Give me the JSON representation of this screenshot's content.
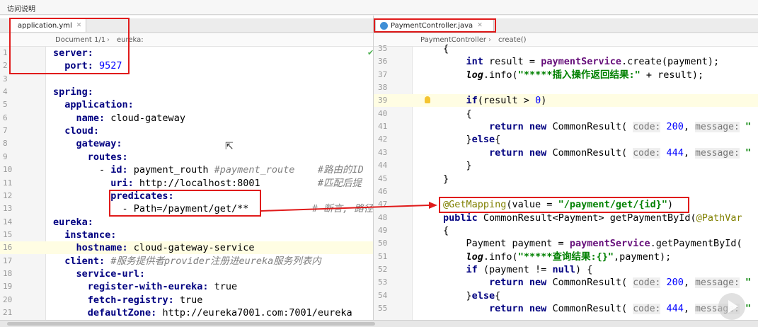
{
  "window": {
    "title": "访问说明"
  },
  "left": {
    "tab_label": "application.yml",
    "breadcrumb": [
      "Document 1/1",
      "›",
      "eureka:"
    ],
    "lines": [
      {
        "n": "1",
        "html": "<span class=\"kw\">server:</span>"
      },
      {
        "n": "2",
        "html": "  <span class=\"kw\">port:</span> <span class=\"num\">9527</span>"
      },
      {
        "n": "3",
        "html": ""
      },
      {
        "n": "4",
        "html": "<span class=\"kw\">spring:</span>"
      },
      {
        "n": "5",
        "html": "  <span class=\"kw\">application:</span>"
      },
      {
        "n": "6",
        "html": "    <span class=\"kw\">name:</span> cloud-gateway"
      },
      {
        "n": "7",
        "html": "  <span class=\"kw\">cloud:</span>"
      },
      {
        "n": "8",
        "html": "    <span class=\"kw\">gateway:</span>"
      },
      {
        "n": "9",
        "html": "      <span class=\"kw\">routes:</span>"
      },
      {
        "n": "10",
        "html": "        - <span class=\"kw\">id:</span> payment_routh <span class=\"cmt\">#payment_route    #路由的ID</span>"
      },
      {
        "n": "11",
        "html": "          <span class=\"kw\">uri:</span> http://localhost:8001          <span class=\"cmt\">#匹配后提</span>"
      },
      {
        "n": "12",
        "html": "          <span class=\"kw\">predicates:</span>"
      },
      {
        "n": "13",
        "html": "            - Path=/payment/get/**           <span class=\"cmt\"># 断言, 路径</span>"
      },
      {
        "n": "14",
        "html": "<span class=\"kw\">eureka:</span>"
      },
      {
        "n": "15",
        "html": "  <span class=\"kw\">instance:</span>"
      },
      {
        "n": "16",
        "html": "    <span class=\"kw\">hostname:</span> cloud-gateway-service"
      },
      {
        "n": "17",
        "html": "  <span class=\"kw\">client:</span> <span class=\"cmt\">#服务提供者provider注册进eureka服务列表内</span>"
      },
      {
        "n": "18",
        "html": "    <span class=\"kw\">service-url:</span>"
      },
      {
        "n": "19",
        "html": "      <span class=\"kw\">register-with-eureka:</span> true"
      },
      {
        "n": "20",
        "html": "      <span class=\"kw\">fetch-registry:</span> true"
      },
      {
        "n": "21",
        "html": "      <span class=\"kw\">defaultZone:</span> http://eureka7001.com:7001/eureka"
      }
    ]
  },
  "right": {
    "tab_label": "PaymentController.java",
    "breadcrumb": [
      "PaymentController",
      "›",
      "create()"
    ],
    "lines": [
      {
        "n": "35",
        "html": "{"
      },
      {
        "n": "36",
        "html": "    <span class=\"kw\">int</span> result = <span class=\"fn\">paymentService</span>.create(payment);"
      },
      {
        "n": "37",
        "html": "    <span class=\"it\">log</span>.info(<span class=\"str\">\"*****插入操作返回结果:\"</span> + result);"
      },
      {
        "n": "38",
        "html": ""
      },
      {
        "n": "39",
        "html": "    <span class=\"kw\">if</span>(result > <span class=\"num\">0</span>)"
      },
      {
        "n": "40",
        "html": "    {"
      },
      {
        "n": "41",
        "html": "        <span class=\"kw\">return new</span> CommonResult( <span class=\"hint\">code:</span> <span class=\"num\">200</span>, <span class=\"hint\">message:</span> <span class=\"str\">\"</span>"
      },
      {
        "n": "42",
        "html": "    }<span class=\"kw\">else</span>{"
      },
      {
        "n": "43",
        "html": "        <span class=\"kw\">return new</span> CommonResult( <span class=\"hint\">code:</span> <span class=\"num\">444</span>, <span class=\"hint\">message:</span> <span class=\"str\">\"</span>"
      },
      {
        "n": "44",
        "html": "    }"
      },
      {
        "n": "45",
        "html": "}"
      },
      {
        "n": "46",
        "html": ""
      },
      {
        "n": "47",
        "html": "<span class=\"ann\">@GetMapping</span>(value = <span class=\"str\">\"/payment/get/{id}\"</span>)"
      },
      {
        "n": "48",
        "html": "<span class=\"kw\">public</span> CommonResult&lt;Payment&gt; getPaymentById(<span class=\"ann\">@PathVar</span>"
      },
      {
        "n": "49",
        "html": "{"
      },
      {
        "n": "50",
        "html": "    Payment payment = <span class=\"fn\">paymentService</span>.getPaymentById("
      },
      {
        "n": "51",
        "html": "    <span class=\"it\">log</span>.info(<span class=\"str\">\"*****查询结果:{}\"</span>,payment);"
      },
      {
        "n": "52",
        "html": "    <span class=\"kw\">if</span> (payment != <span class=\"kw\">null</span>) {"
      },
      {
        "n": "53",
        "html": "        <span class=\"kw\">return new</span> CommonResult( <span class=\"hint\">code:</span> <span class=\"num\">200</span>, <span class=\"hint\">message:</span> <span class=\"str\">\"</span>"
      },
      {
        "n": "54",
        "html": "    }<span class=\"kw\">else</span>{"
      },
      {
        "n": "55",
        "html": "        <span class=\"kw\">return new</span> CommonResult( <span class=\"hint\">code:</span> <span class=\"num\">444</span>, <span class=\"hint\">message:</span> <span class=\"str\">\"</span>"
      }
    ]
  },
  "colors": {
    "annotation_red": "#e01b1b",
    "keyword": "#000080",
    "string": "#008000"
  }
}
